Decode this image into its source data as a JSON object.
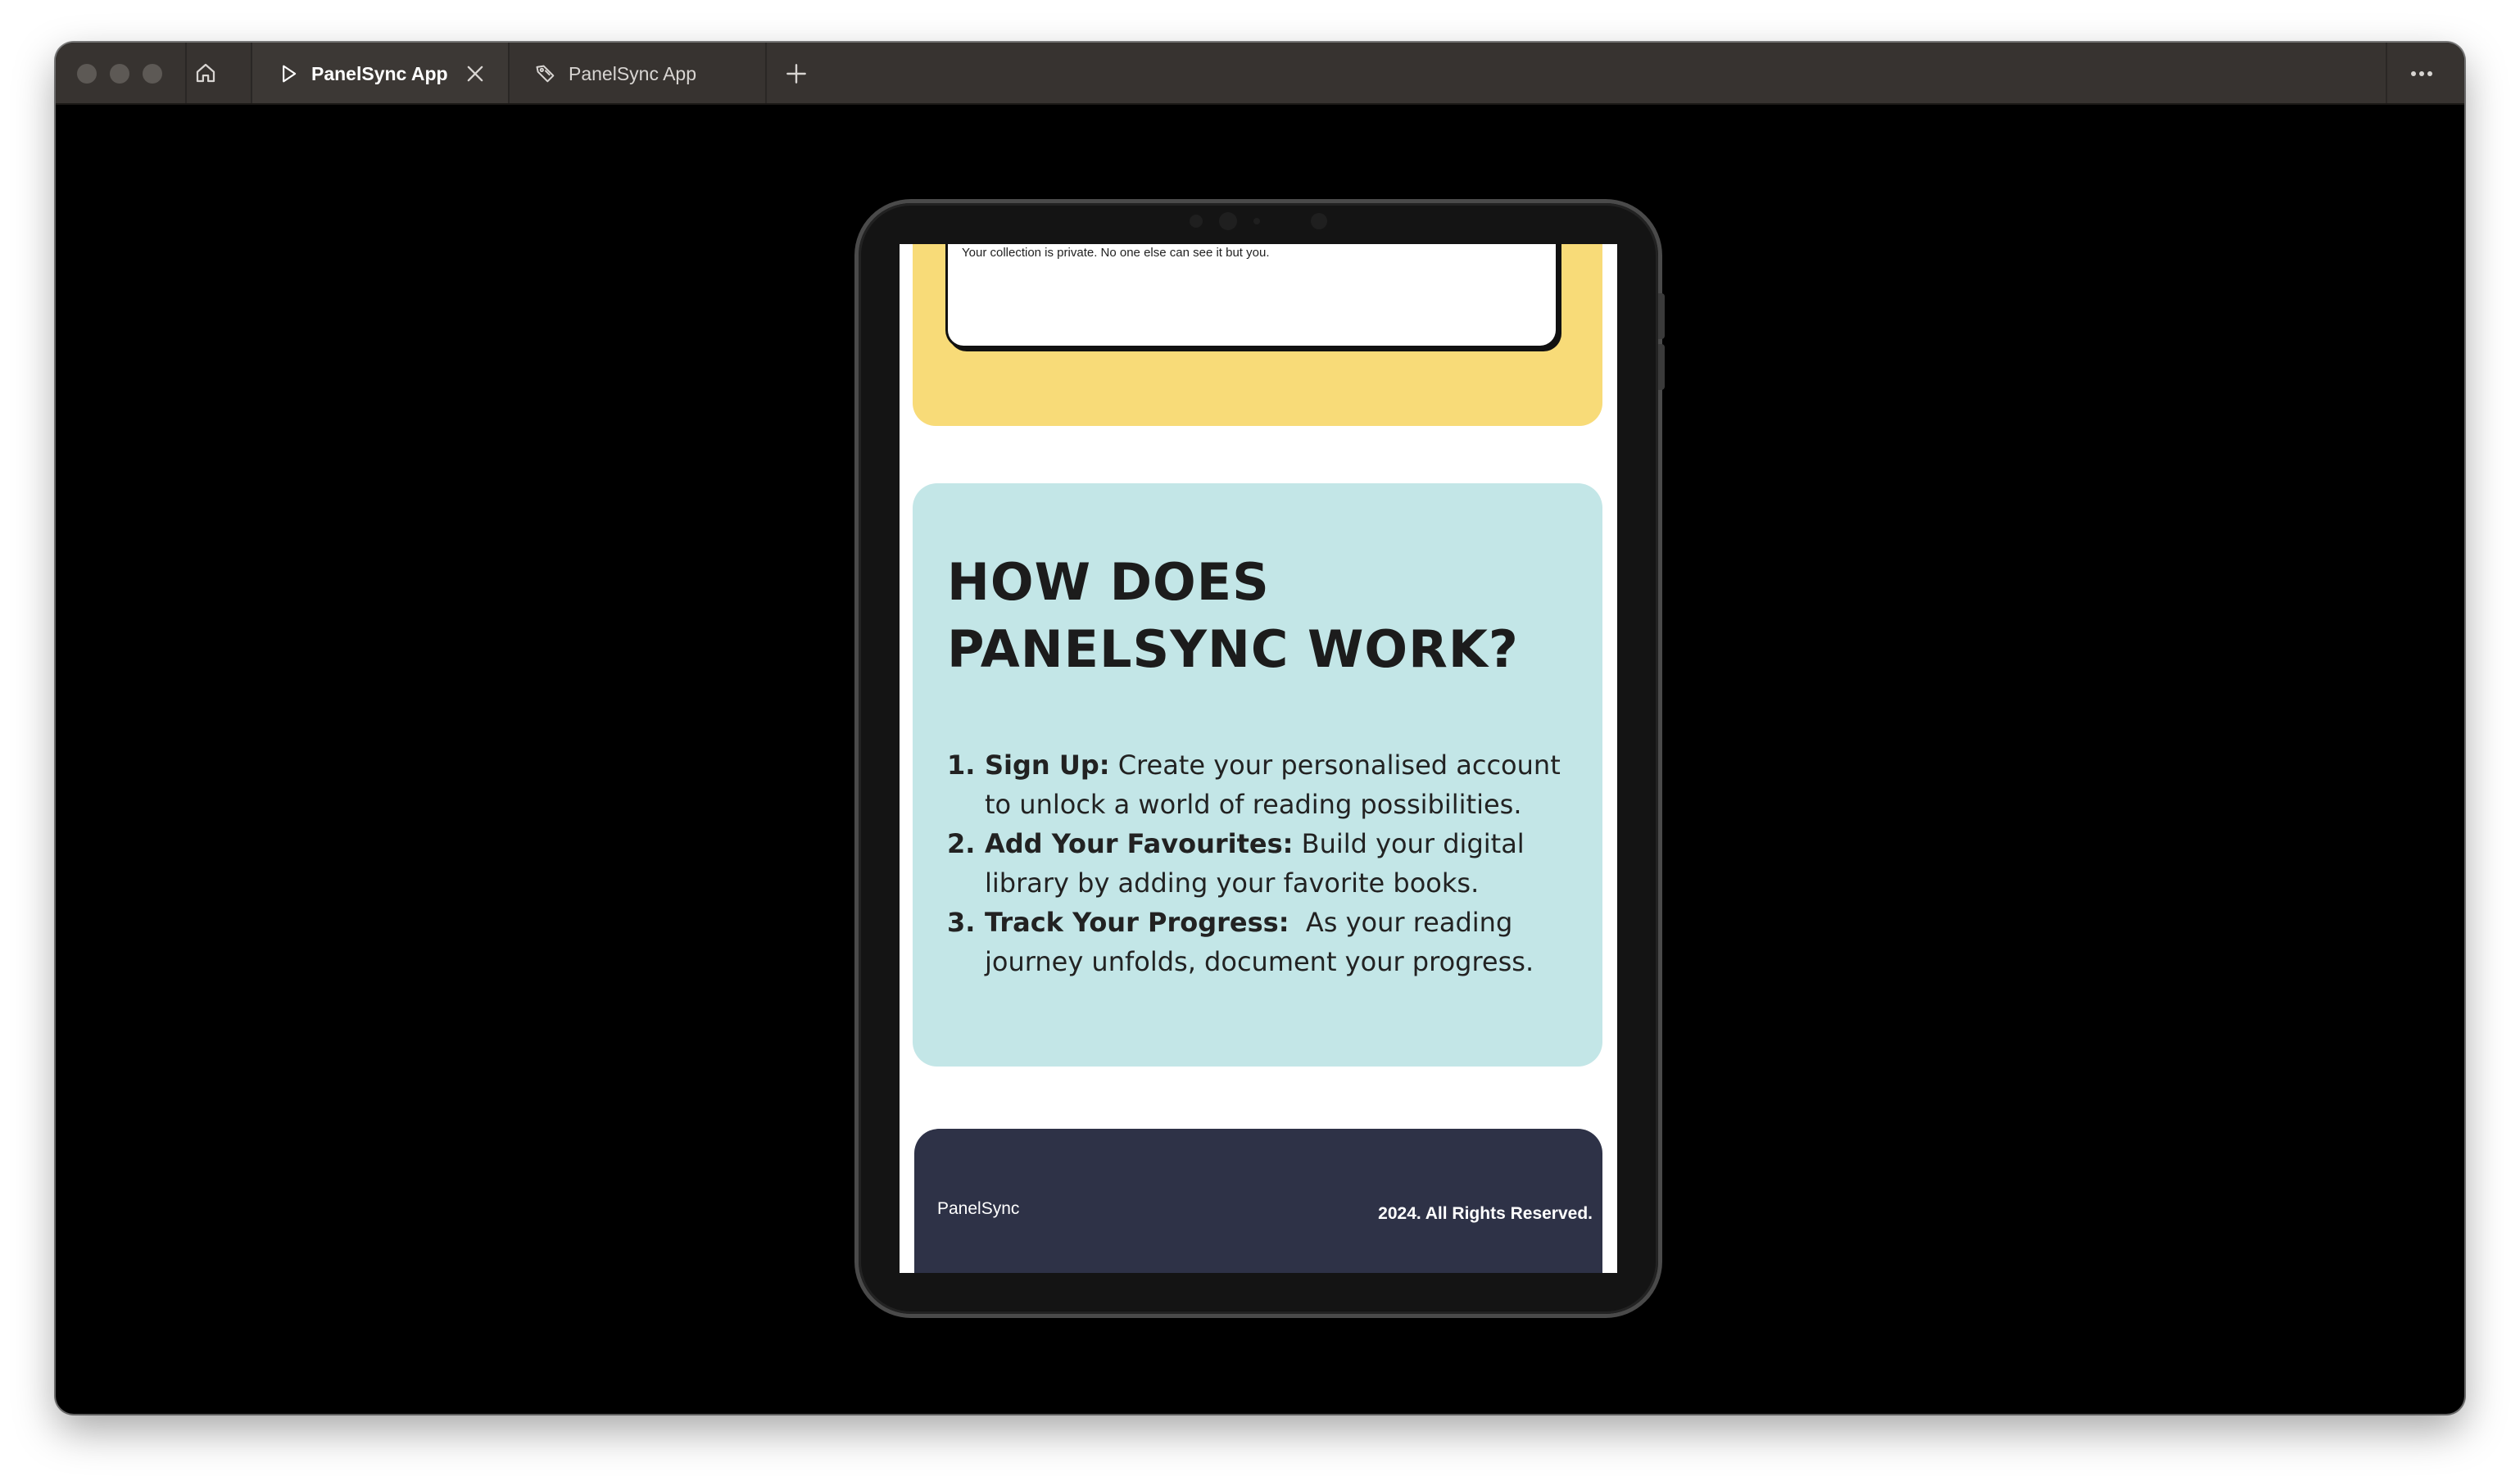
{
  "browser": {
    "tabs": [
      {
        "label": "PanelSync App",
        "icon": "play-icon",
        "active": true
      },
      {
        "label": "PanelSync App",
        "icon": "tag-icon",
        "active": false
      }
    ]
  },
  "page": {
    "privacy_note": "Your collection is private. No one else can see it but you.",
    "how_title": "HOW DOES PANELSYNC WORK?",
    "steps": [
      {
        "num": "1.",
        "head": "Sign Up:",
        "text": " Create your personalised account to unlock a world of reading possibilities."
      },
      {
        "num": "2.",
        "head": "Add Your Favourites:",
        "text": " Build your digital library by adding your favorite books."
      },
      {
        "num": "3.",
        "head": "Track Your Progress:",
        "text": "  As your reading journey unfolds, document your progress."
      }
    ],
    "footer": {
      "brand": "PanelSync",
      "rights": "2024. All Rights Reserved."
    }
  },
  "colors": {
    "yellow": "#f8db78",
    "teal": "#c3e6e7",
    "footer": "#2e3247"
  }
}
